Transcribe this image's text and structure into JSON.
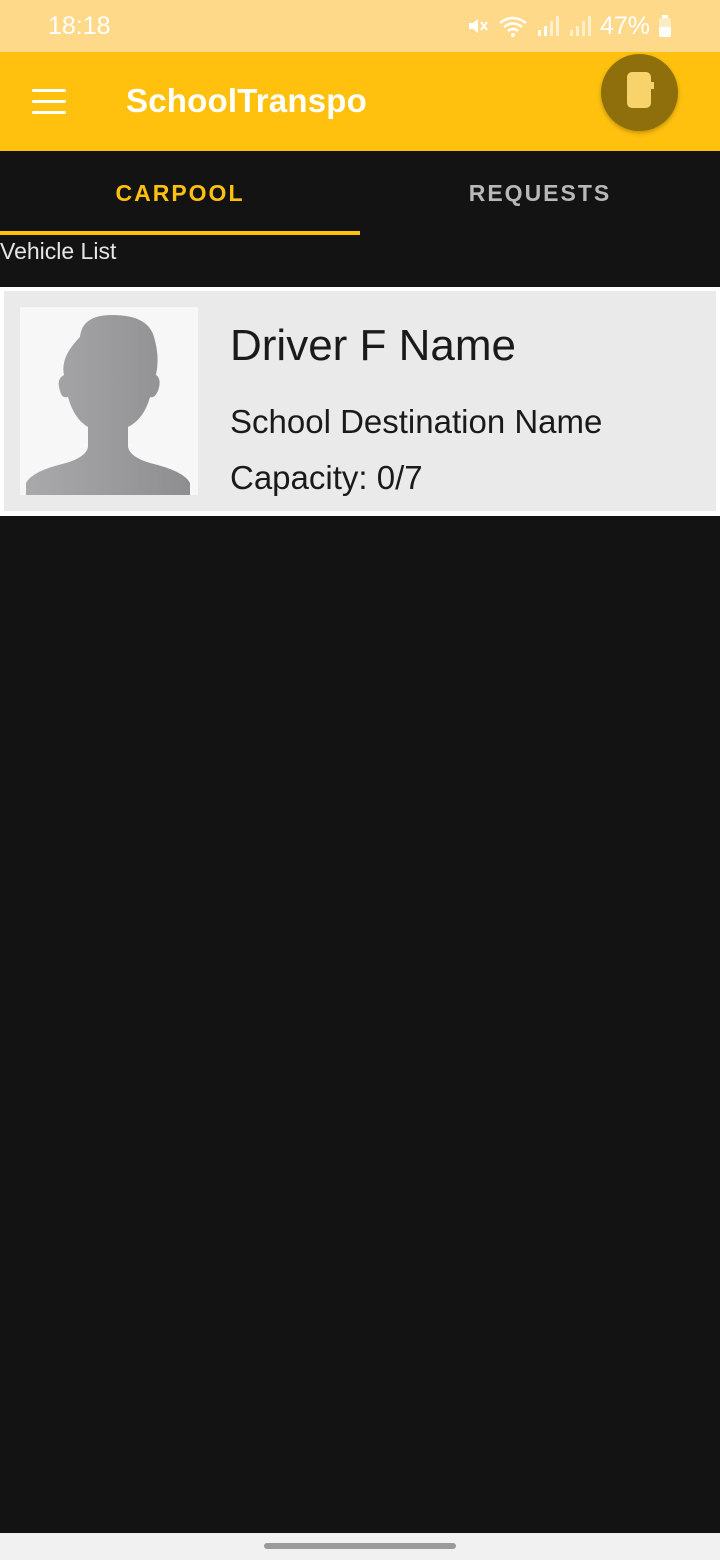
{
  "status_bar": {
    "time": "18:18",
    "battery_percent": "47%",
    "icons": [
      "mute-icon",
      "wifi-icon",
      "signal-icon",
      "signal-icon",
      "battery-icon"
    ]
  },
  "app_bar": {
    "title": "SchoolTranspo",
    "menu_icon": "hamburger-menu-icon",
    "action_icon": "phone-icon",
    "color": "#FFC10E"
  },
  "tabs": [
    {
      "label": "CARPOOL",
      "active": true
    },
    {
      "label": "REQUESTS",
      "active": false
    }
  ],
  "section_label": "Vehicle List",
  "vehicles": [
    {
      "driver_name": "Driver F Name",
      "destination": "School Destination Name",
      "capacity": "Capacity: 0/7",
      "avatar_icon": "person-silhouette-icon"
    }
  ],
  "colors": {
    "accent": "#FFC10E",
    "background": "#131313",
    "status_bar": "#FFD98A"
  }
}
